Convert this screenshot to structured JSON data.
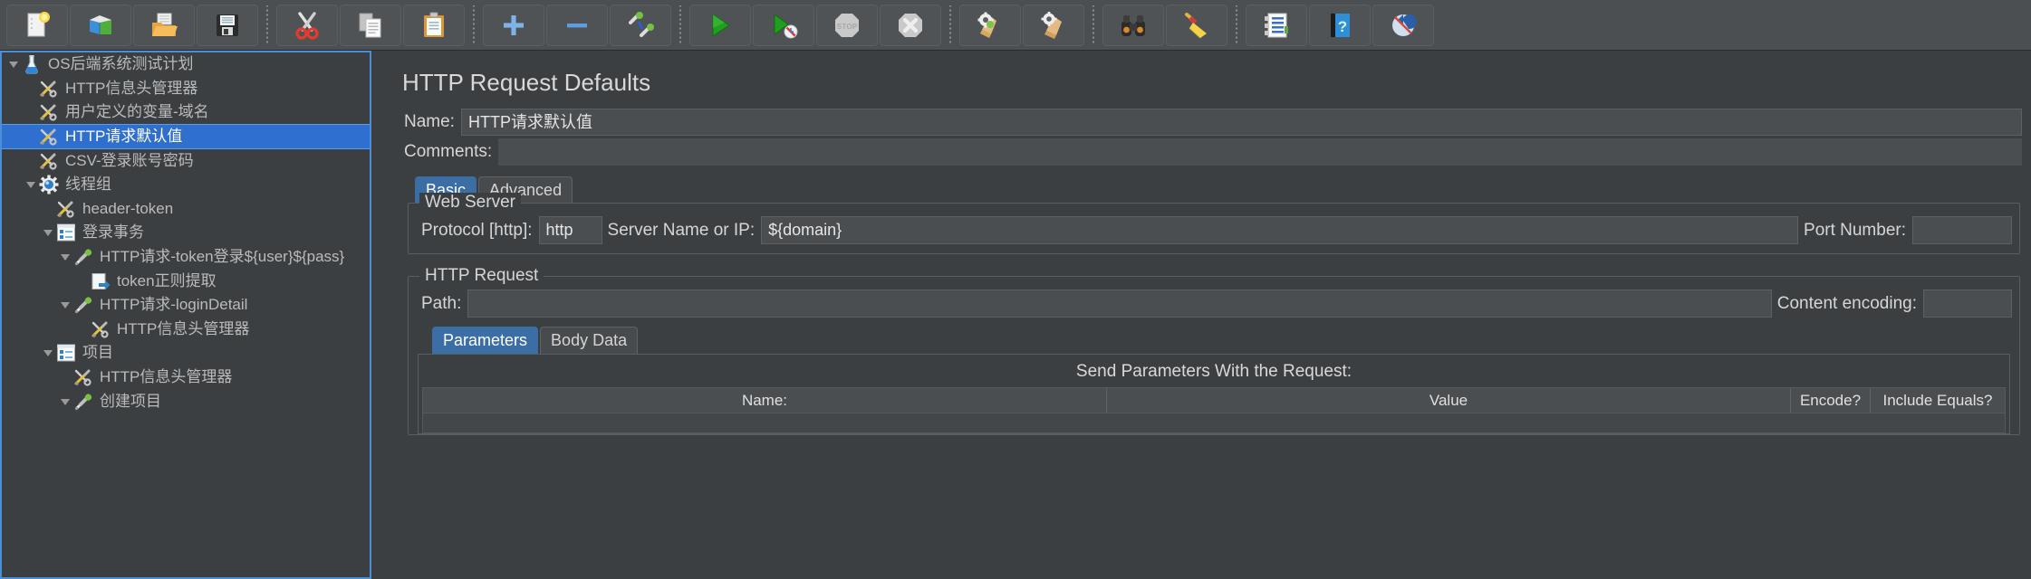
{
  "toolbar": {
    "buttons": [
      {
        "name": "new-test-plan",
        "icon": "new-document-icon"
      },
      {
        "name": "templates",
        "icon": "templates-icon"
      },
      {
        "name": "open-test-plan",
        "icon": "open-folder-icon"
      },
      {
        "name": "save-test-plan",
        "icon": "save-disk-icon"
      },
      {
        "name": "separator",
        "icon": "separator"
      },
      {
        "name": "cut",
        "icon": "scissors-icon"
      },
      {
        "name": "copy",
        "icon": "copy-pages-icon"
      },
      {
        "name": "paste",
        "icon": "clipboard-icon"
      },
      {
        "name": "separator",
        "icon": "separator"
      },
      {
        "name": "expand-all",
        "icon": "plus-icon"
      },
      {
        "name": "collapse-all",
        "icon": "minus-icon"
      },
      {
        "name": "toggle",
        "icon": "toggle-pins-icon"
      },
      {
        "name": "separator",
        "icon": "separator"
      },
      {
        "name": "start",
        "icon": "play-green-icon"
      },
      {
        "name": "start-no-pauses",
        "icon": "play-no-timers-icon"
      },
      {
        "name": "stop",
        "icon": "stop-octagon-icon"
      },
      {
        "name": "shutdown",
        "icon": "shutdown-x-icon"
      },
      {
        "name": "separator",
        "icon": "separator"
      },
      {
        "name": "clear",
        "icon": "broom-gear-icon"
      },
      {
        "name": "clear-all",
        "icon": "broom-all-icon"
      },
      {
        "name": "separator",
        "icon": "separator"
      },
      {
        "name": "search",
        "icon": "binoculars-icon"
      },
      {
        "name": "reset-search",
        "icon": "yellow-broom-icon"
      },
      {
        "name": "separator",
        "icon": "separator"
      },
      {
        "name": "function-helper",
        "icon": "function-list-icon"
      },
      {
        "name": "help",
        "icon": "help-book-icon"
      },
      {
        "name": "undo",
        "icon": "undo-icon"
      }
    ]
  },
  "tree": {
    "nodes": [
      {
        "label": "OS后端系统测试计划",
        "depth": 0,
        "icon": "test-plan-flask-icon",
        "toggle": "expanded",
        "selected": false
      },
      {
        "label": "HTTP信息头管理器",
        "depth": 1,
        "icon": "config-wrench-icon",
        "toggle": "none",
        "selected": false
      },
      {
        "label": "用户定义的变量-域名",
        "depth": 1,
        "icon": "config-wrench-icon",
        "toggle": "none",
        "selected": false
      },
      {
        "label": "HTTP请求默认值",
        "depth": 1,
        "icon": "config-wrench-icon",
        "toggle": "none",
        "selected": true
      },
      {
        "label": "CSV-登录账号密码",
        "depth": 1,
        "icon": "config-wrench-icon",
        "toggle": "none",
        "selected": false
      },
      {
        "label": "线程组",
        "depth": 1,
        "icon": "thread-group-gear-icon",
        "toggle": "expanded",
        "selected": false
      },
      {
        "label": "header-token",
        "depth": 2,
        "icon": "config-wrench-icon",
        "toggle": "none",
        "selected": false
      },
      {
        "label": "登录事务",
        "depth": 2,
        "icon": "transaction-controller-icon",
        "toggle": "expanded",
        "selected": false
      },
      {
        "label": "HTTP请求-token登录${user}${pass}",
        "depth": 3,
        "icon": "http-sampler-pipette-icon",
        "toggle": "expanded",
        "selected": false
      },
      {
        "label": "token正则提取",
        "depth": 4,
        "icon": "post-processor-icon",
        "toggle": "none",
        "selected": false
      },
      {
        "label": "HTTP请求-loginDetail",
        "depth": 3,
        "icon": "http-sampler-pipette-icon",
        "toggle": "expanded",
        "selected": false
      },
      {
        "label": "HTTP信息头管理器",
        "depth": 4,
        "icon": "config-wrench-icon",
        "toggle": "none",
        "selected": false
      },
      {
        "label": "项目",
        "depth": 2,
        "icon": "transaction-controller-icon",
        "toggle": "expanded",
        "selected": false
      },
      {
        "label": "HTTP信息头管理器",
        "depth": 3,
        "icon": "config-wrench-icon",
        "toggle": "none",
        "selected": false
      },
      {
        "label": "创建项目",
        "depth": 3,
        "icon": "http-sampler-pipette-icon",
        "toggle": "expanded",
        "selected": false
      }
    ]
  },
  "panel": {
    "title": "HTTP Request Defaults",
    "name_label": "Name:",
    "name_value": "HTTP请求默认值",
    "comments_label": "Comments:",
    "comments_value": "",
    "tabs": [
      {
        "label": "Basic",
        "active": true
      },
      {
        "label": "Advanced",
        "active": false
      }
    ],
    "web_server": {
      "group_title": "Web Server",
      "protocol_label": "Protocol [http]:",
      "protocol_value": "http",
      "server_label": "Server Name or IP:",
      "server_value": "${domain}",
      "port_label": "Port Number:",
      "port_value": ""
    },
    "http_request": {
      "group_title": "HTTP Request",
      "path_label": "Path:",
      "path_value": "",
      "encoding_label": "Content encoding:",
      "encoding_value": "",
      "sub_tabs": [
        {
          "label": "Parameters",
          "active": true
        },
        {
          "label": "Body Data",
          "active": false
        }
      ],
      "send_params_title": "Send Parameters With the Request:",
      "table_headers": [
        "Name:",
        "Value",
        "Encode?",
        "Include Equals?"
      ],
      "rows": []
    }
  },
  "colors": {
    "accent": "#2f6fce",
    "tab_active": "#3a6ea5",
    "panel_bg": "#3c3f41",
    "toolbar_bg": "#4b4f52",
    "text": "#d6d6d6",
    "focus_border": "#4a90d9"
  }
}
